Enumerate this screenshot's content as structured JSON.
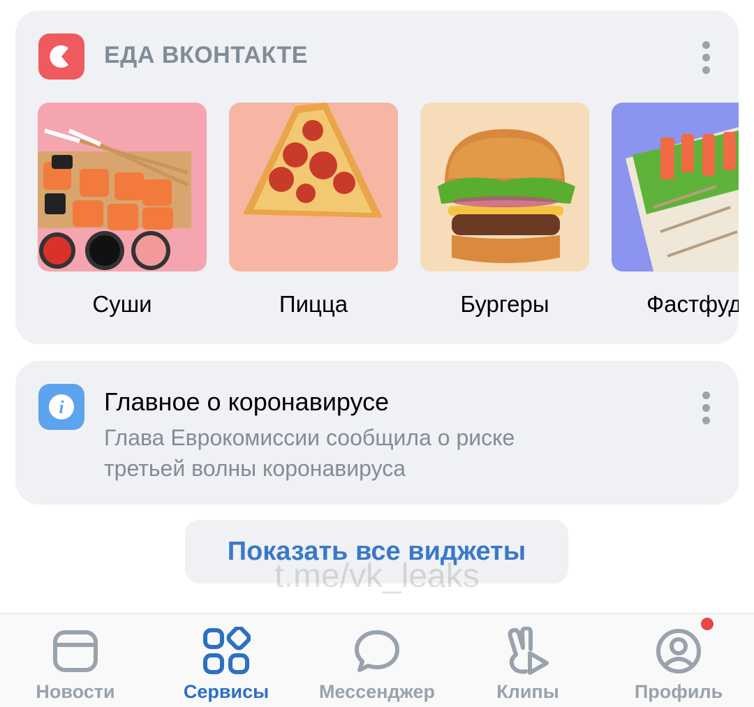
{
  "food_widget": {
    "title": "ЕДА ВКОНТАКТЕ",
    "icon": "food-app-icon",
    "accent": "#ef5a5e",
    "categories": [
      {
        "label": "Суши",
        "image": "sushi-image"
      },
      {
        "label": "Пицца",
        "image": "pizza-image"
      },
      {
        "label": "Бургеры",
        "image": "burger-image"
      },
      {
        "label": "Фастфуд",
        "image": "shawarma-image"
      }
    ]
  },
  "news_widget": {
    "icon": "info-icon",
    "title": "Главное о коронавирусе",
    "text": "Глава Еврокомиссии сообщила о риске третьей волны коронавируса"
  },
  "show_all_label": "Показать все виджеты",
  "watermark": "t.me/vk_leaks",
  "tabbar": {
    "items": [
      {
        "label": "Новости",
        "icon": "news-icon",
        "active": false
      },
      {
        "label": "Сервисы",
        "icon": "services-icon",
        "active": true
      },
      {
        "label": "Мессенджер",
        "icon": "messenger-icon",
        "active": false
      },
      {
        "label": "Клипы",
        "icon": "clips-icon",
        "active": false
      },
      {
        "label": "Профиль",
        "icon": "profile-icon",
        "active": false,
        "badge": true
      }
    ],
    "active_color": "#2d6fc4",
    "inactive_color": "#99a2ad"
  }
}
